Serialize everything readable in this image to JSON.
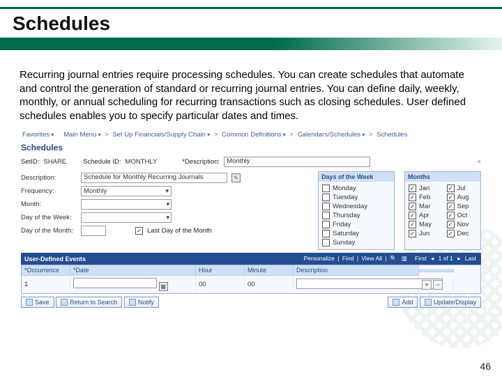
{
  "slide": {
    "title": "Schedules",
    "body": "Recurring journal entries require processing schedules. You can create schedules that automate and control the generation of standard or recurring journal entries.  You can define daily, weekly, monthly, or annual scheduling for recurring transactions such as closing schedules. User defined schedules enables you to specify particular dates and times.",
    "page_number": "46"
  },
  "breadcrumb": {
    "favorites": "Favorites",
    "main_menu": "Main Menu",
    "setup": "Set Up Financials/Supply Chain",
    "common": "Common Definitions",
    "calendars": "Calendars/Schedules",
    "schedules": "Schedules"
  },
  "page_heading": "Schedules",
  "fields": {
    "setid_label": "SetID:",
    "setid_value": "SHARE",
    "schedid_label": "Schedule ID:",
    "schedid_value": "MONTHLY",
    "desc_star_label": "*Description:",
    "desc_star_value": "Monthly",
    "desc_label": "Description:",
    "desc_value": "Schedule for Monthly Recurring Journals",
    "freq_label": "Frequency:",
    "freq_value": "Monthly",
    "month_label": "Month:",
    "dow_label": "Day of the Week:",
    "dom_label": "Day of the Month:",
    "last_day_label": "Last Day of the Month"
  },
  "days_panel": {
    "title": "Days of the Week",
    "items": [
      "Monday",
      "Tuesday",
      "Wednesday",
      "Thursday",
      "Friday",
      "Saturday",
      "Sunday"
    ]
  },
  "months_panel": {
    "title": "Months",
    "left": [
      "Jan",
      "Feb",
      "Mar",
      "Apr",
      "May",
      "Jun"
    ],
    "right": [
      "Jul",
      "Aug",
      "Sep",
      "Oct",
      "Nov",
      "Dec"
    ]
  },
  "ude": {
    "title": "User-Defined Events",
    "tools": {
      "personalize": "Personalize",
      "find": "Find",
      "viewall": "View All",
      "first": "First",
      "count": "1 of 1",
      "last": "Last"
    },
    "cols": {
      "occ": "*Occurrence",
      "date": "*Date",
      "hour": "Hour",
      "minute": "Minute",
      "desc": "Description"
    },
    "row": {
      "occ": "1",
      "hour": "00",
      "minute": "00"
    }
  },
  "actions": {
    "save": "Save",
    "return": "Return to Search",
    "notify": "Notify",
    "add": "Add",
    "update": "Update/Display"
  }
}
